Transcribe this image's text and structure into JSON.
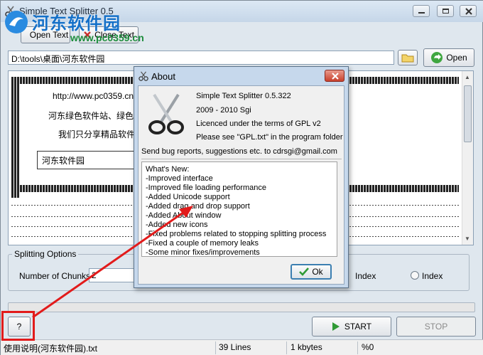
{
  "window": {
    "title": "Simple Text Splitter 0.5"
  },
  "watermark": {
    "cn": "河东软件园",
    "url": "www.pc0359.cn"
  },
  "toolbar": {
    "open_text": "Open Text",
    "close_text": "Close Text",
    "open": "Open"
  },
  "path": {
    "value": "D:\\tools\\桌面\\河东软件园"
  },
  "preview": {
    "lines": [
      "http://www.pc0359.cn",
      "河东绿色软件站、绿色",
      "我们只分享精品软件"
    ],
    "box_label": "河东软件园"
  },
  "splitting": {
    "group_title": "Splitting Options",
    "chunks_label": "Number of Chunks:",
    "chunks_value": "2",
    "radio1": "Index",
    "radio2": "Index"
  },
  "buttons": {
    "help": "?",
    "start": "START",
    "stop": "STOP"
  },
  "status": {
    "file": "使用说明(河东软件园).txt",
    "lines": "39 Lines",
    "size": "1 kbytes",
    "percent": "%0"
  },
  "about": {
    "title": "About",
    "app": "Simple Text Splitter 0.5.322",
    "years": "2009 - 2010 Sgi",
    "license": "Licenced under the terms of GPL v2",
    "see": "Please see \"GPL.txt\" in the program folder",
    "bugs": "Send bug reports, suggestions etc. to cdrsgi@gmail.com",
    "whats_new": [
      "What's New:",
      "-Improved interface",
      "-Improved file loading performance",
      "-Added Unicode support",
      "-Added drag and drop support",
      "-Added About window",
      "-Added new icons",
      "-Fixed problems related to stopping splitting process",
      "-Fixed a couple of memory leaks",
      "-Some minor fixes/improvements"
    ],
    "ok": "Ok"
  },
  "colors": {
    "accent_red": "#e21b1b",
    "window_bg": "#dfe7ee",
    "dialog_frame": "#c6d8ec"
  }
}
